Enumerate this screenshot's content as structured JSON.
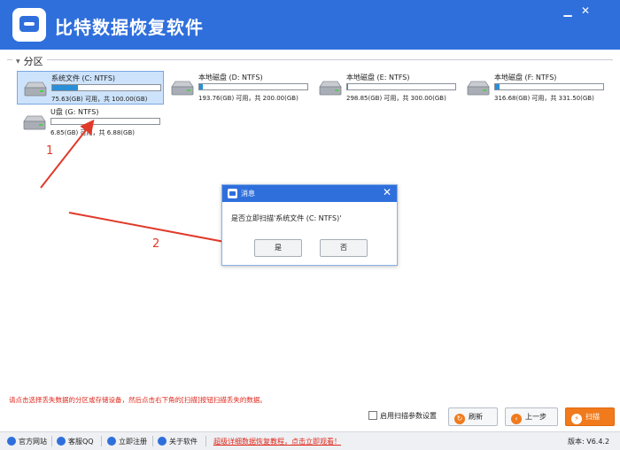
{
  "app": {
    "title": "比特数据恢复软件",
    "minimize": "▁",
    "close": "✕"
  },
  "partition_group": {
    "label": "分区"
  },
  "drives": [
    {
      "name": "系统文件 (C: NTFS)",
      "info": "75.63(GB) 可用，共 100.00(GB)",
      "fill_fraction": 0.24,
      "selected": true
    },
    {
      "name": "本地磁盘 (D: NTFS)",
      "info": "193.76(GB) 可用，共 200.00(GB)",
      "fill_fraction": 0.03,
      "selected": false
    },
    {
      "name": "本地磁盘 (E: NTFS)",
      "info": "298.85(GB) 可用，共 300.00(GB)",
      "fill_fraction": 0.01,
      "selected": false
    },
    {
      "name": "本地磁盘 (F: NTFS)",
      "info": "316.68(GB) 可用，共 331.50(GB)",
      "fill_fraction": 0.04,
      "selected": false
    },
    {
      "name": "U盘 (G: NTFS)",
      "info": "6.85(GB) 可用，共 6.88(GB)",
      "fill_fraction": 0.0,
      "selected": false
    }
  ],
  "annotations": {
    "step1": "1",
    "step2": "2",
    "color": "#e03a2a"
  },
  "dialog": {
    "title": "消息",
    "close": "✕",
    "message": "是否立即扫描'系统文件 (C: NTFS)'",
    "yes": "是",
    "no": "否"
  },
  "footer": {
    "hint": "请点击选择丢失数据的分区或存储设备，然后点击右下角的[扫描]按钮扫描丢失的数据。",
    "scan_params_label": "启用扫描参数设置",
    "refresh": "刷新",
    "prev": "上一步",
    "scan": "扫描"
  },
  "statusbar": {
    "website": "官方网站",
    "qq": "客服QQ",
    "register": "立即注册",
    "about": "关于软件",
    "promo": "超级详细数据恢复教程，点击立即观看！",
    "version": "版本: V6.4.2"
  },
  "colors": {
    "brand_blue": "#2f6fdc",
    "accent_orange": "#f07a1c",
    "warning_red": "#e0281c"
  }
}
